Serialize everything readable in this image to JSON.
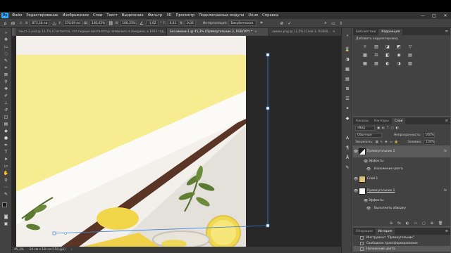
{
  "app": {
    "logo": "Ps"
  },
  "menu": [
    "Файл",
    "Редактирование",
    "Изображение",
    "Слои",
    "Текст",
    "Выделение",
    "Фильтр",
    "3D",
    "Просмотр",
    "Подключаемые модули",
    "Окно",
    "Справка"
  ],
  "window_controls": {
    "minimize": "—",
    "maximize": "□",
    "close": "✕"
  },
  "options": {
    "x_value": "873,18 пи",
    "y_value": "370,09 пи",
    "w_value": "100,03%",
    "h_value": "106,33%",
    "angle_value": "-1,62",
    "h_skew": "0,61",
    "v_skew": "0,00",
    "interp_label": "Интерполяция:",
    "interp_value": "Бикубическая"
  },
  "tabs": [
    {
      "label": "текст-2.psd @ 16,7% (Считается, что первые вентилятор появились в Америке, в 1903 год...",
      "active": false
    },
    {
      "label": "Без имени-1 @ 45,3% (Прямоугольник 2, RGB/16*) *",
      "active": true
    },
    {
      "label": "лимон.png @ 12,5% (Слой 1, RGB/8...",
      "active": false
    }
  ],
  "status": {
    "zoom": "45,3%",
    "dims": "24 см x 18 см (150 ppi)"
  },
  "panel_adjust": {
    "tabs": [
      "Библиотеки",
      "Коррекция"
    ],
    "active": 1,
    "title": "Добавить корректировку",
    "icons": [
      "☼",
      "▥",
      "◪",
      "◩",
      "▽",
      "▦",
      "⚖",
      "◧",
      "◉",
      "▤",
      "▦",
      "▨",
      "◐",
      "◑",
      "▧"
    ]
  },
  "panel_layers": {
    "tabs": [
      "Каналы",
      "Контуры",
      "Слои"
    ],
    "active": 2,
    "filter": "Вид",
    "blend": "Обычные",
    "opacity_label": "Непрозрачность:",
    "opacity_value": "100%",
    "lock_label": "Закрепить:",
    "fill_label": "Заливка:",
    "fill_value": "100%",
    "layers": [
      {
        "name": "Прямоугольник 2",
        "type": "main",
        "selected": true,
        "fx": "fx"
      },
      {
        "name": "Эффекты",
        "type": "sub"
      },
      {
        "name": "Наложение цвета",
        "type": "sub2"
      },
      {
        "name": "Слой 1",
        "type": "main",
        "selected": false,
        "fx": ""
      },
      {
        "name": "Прямоугольник 1",
        "type": "main",
        "selected": false,
        "fx": "fx"
      },
      {
        "name": "Эффекты",
        "type": "sub"
      },
      {
        "name": "Выполнить обводку",
        "type": "sub2"
      }
    ],
    "footer_icons": [
      "⊖",
      "fx",
      "◐",
      "▭",
      "▢",
      "⊕",
      "🗑"
    ]
  },
  "panel_history": {
    "tabs": [
      "Операции",
      "История"
    ],
    "active": 1,
    "items": [
      {
        "label": "Инструмент \"Прямоугольник\"",
        "current": false
      },
      {
        "label": "Свободное трансформирование",
        "current": false
      },
      {
        "label": "Наложение цвета",
        "current": true
      }
    ]
  }
}
